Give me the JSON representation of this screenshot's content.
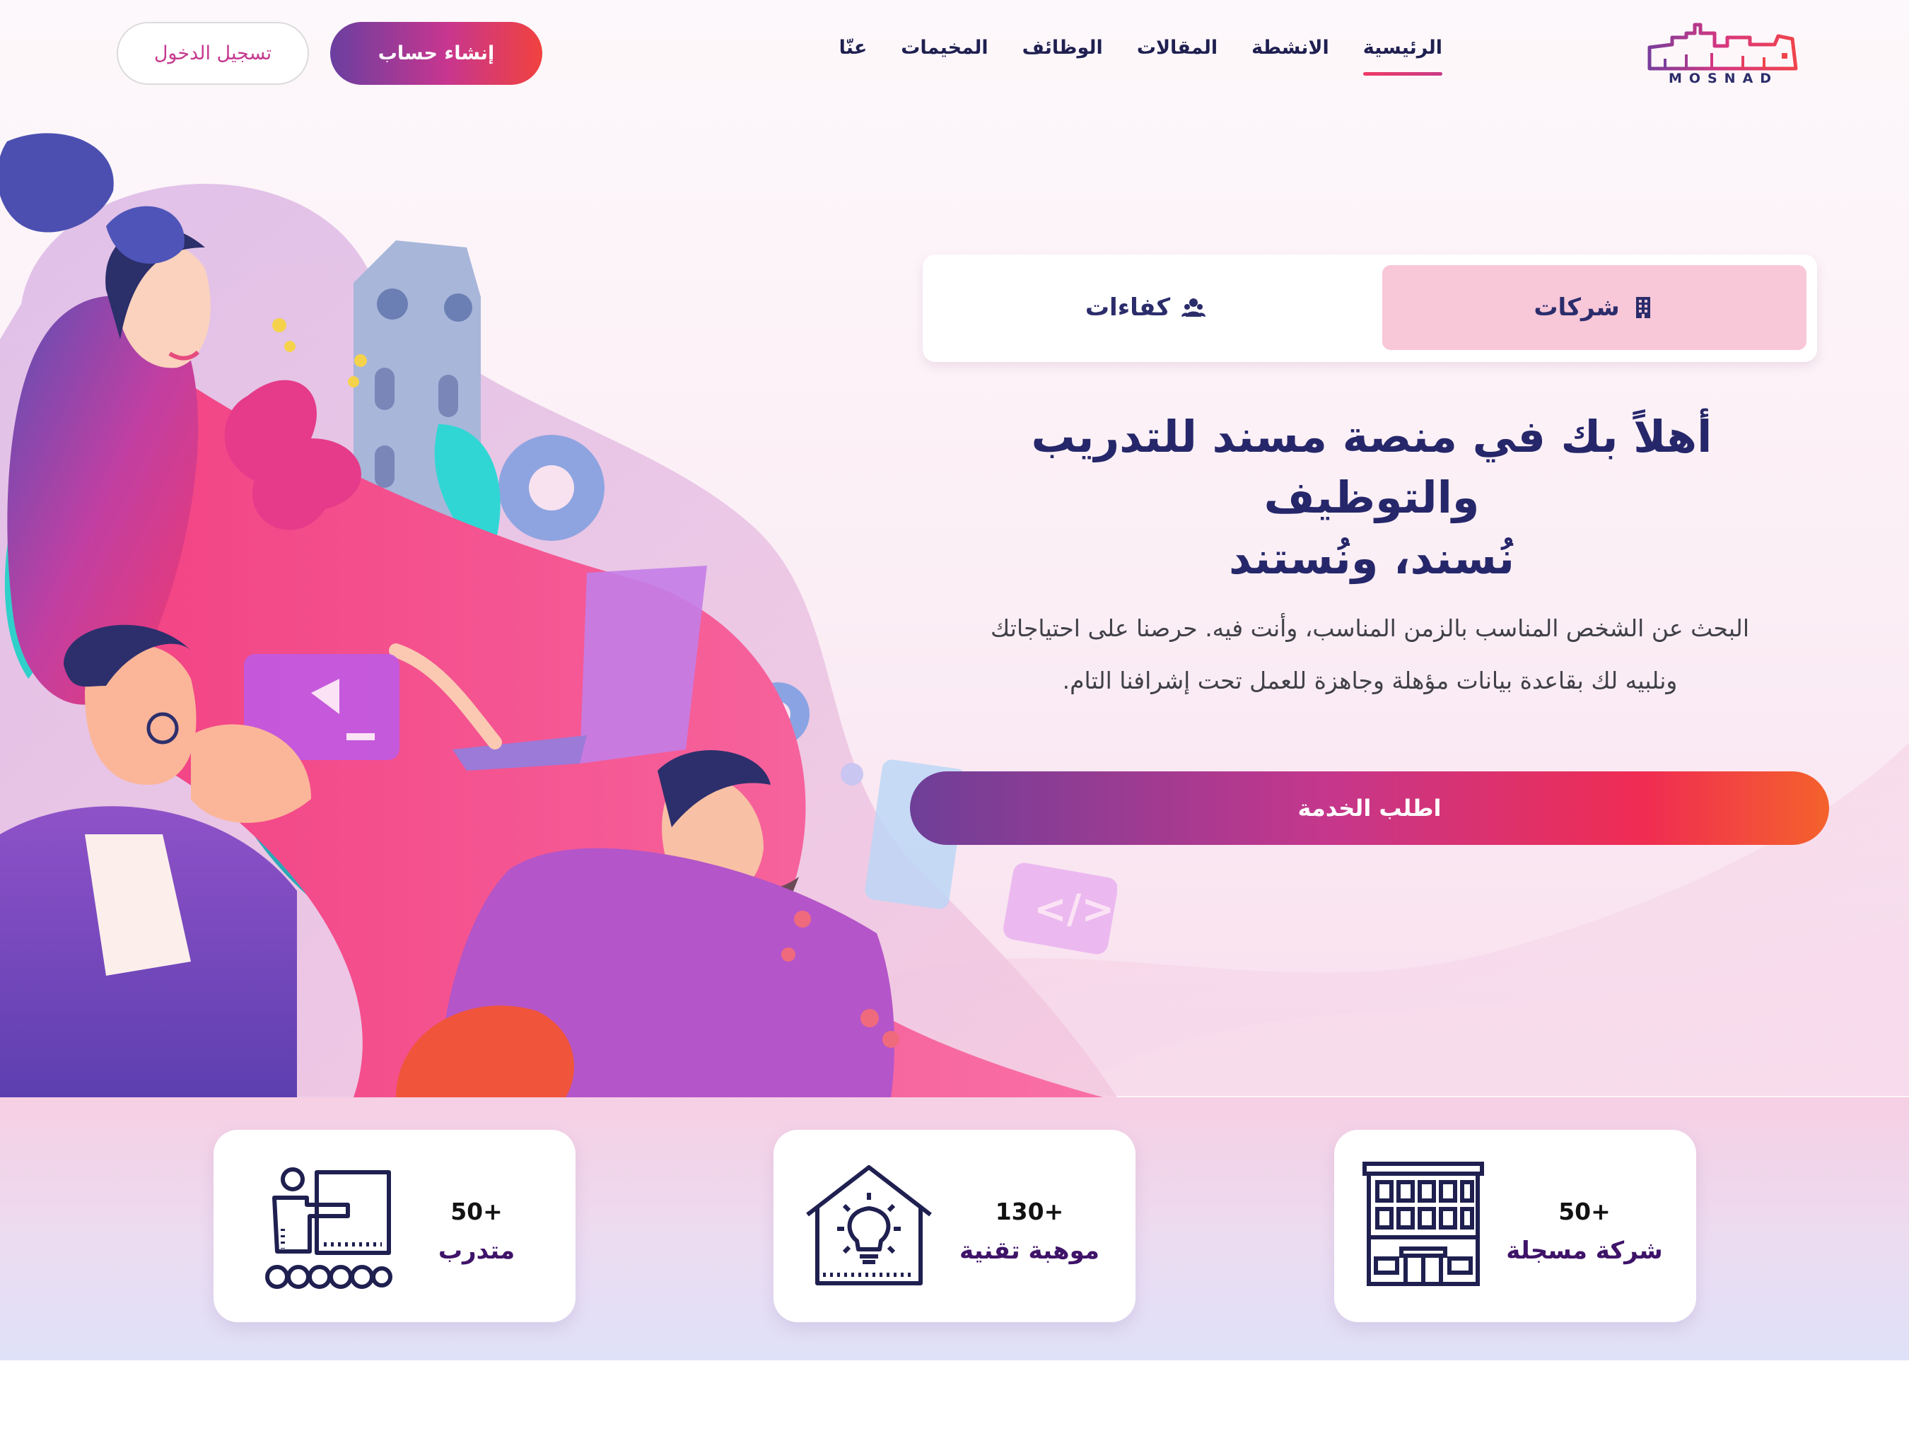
{
  "brand": {
    "logo_text": "MOSNAD"
  },
  "nav": {
    "items": [
      {
        "label": "الرئيسية",
        "active": true
      },
      {
        "label": "الانشطة",
        "active": false
      },
      {
        "label": "المقالات",
        "active": false
      },
      {
        "label": "الوظائف",
        "active": false
      },
      {
        "label": "المخيمات",
        "active": false
      },
      {
        "label": "عنّا",
        "active": false
      }
    ],
    "register_label": "إنشاء حساب",
    "login_label": "تسجيل الدخول"
  },
  "tabs": {
    "companies_label": "شركات",
    "talents_label": "كفاءات",
    "selected": "companies"
  },
  "hero": {
    "title_line1": "أهلاً بك في منصة مسند للتدريب والتوظيف",
    "title_line2": "نُسند، ونُستند",
    "description_line1": "البحث عن الشخص المناسب بالزمن المناسب، وأنت فيه. حرصنا على احتياجاتك",
    "description_line2": "ونلبيه لك بقاعدة بيانات مؤهلة وجاهزة للعمل تحت إشرافنا التام.",
    "cta_label": "اطلب الخدمة"
  },
  "stats": [
    {
      "value": "50+",
      "label": "شركة مسجلة",
      "icon": "building-icon"
    },
    {
      "value": "130+",
      "label": "موهبة تقنية",
      "icon": "lightbulb-house-icon"
    },
    {
      "value": "50+",
      "label": "متدرب",
      "icon": "trainer-icon"
    }
  ],
  "colors": {
    "primary_dark": "#26276a",
    "accent_pink": "#c5368e",
    "accent_red": "#f02c52",
    "accent_orange": "#f4622c",
    "accent_purple": "#6e3f98",
    "tab_selected_bg": "#f8c7d8"
  }
}
